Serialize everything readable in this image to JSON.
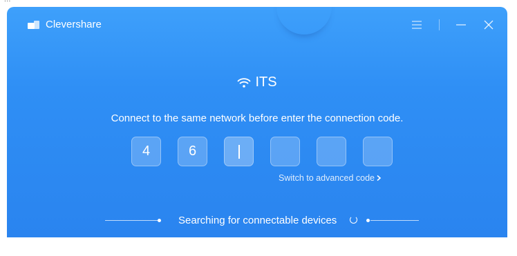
{
  "background_fragment": "...",
  "app": {
    "title": "Clevershare",
    "logo_icon": "clevershare-logo-icon"
  },
  "window_controls": {
    "menu_icon": "hamburger-menu-icon",
    "minimize_icon": "minimize-icon",
    "close_icon": "close-icon"
  },
  "network": {
    "icon": "wifi-icon",
    "name": "ITS"
  },
  "instruction": "Connect to the same network before enter the connection code.",
  "code": {
    "digits": [
      "4",
      "6",
      "",
      "",
      "",
      ""
    ],
    "active_index": 2
  },
  "advanced_link": {
    "label": "Switch to advanced code",
    "icon": "chevron-right-icon"
  },
  "status": {
    "text": "Searching for connectable devices",
    "icon": "loading-spinner-icon"
  },
  "colors": {
    "window_top": "#3ea0fb",
    "window_bottom": "#2a84ef",
    "text": "#ffffff"
  }
}
